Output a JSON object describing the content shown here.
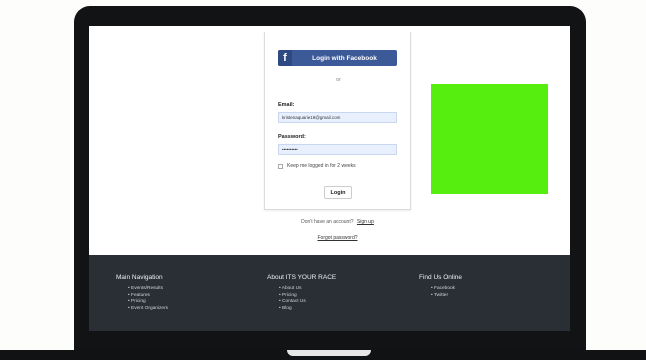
{
  "colors": {
    "facebook_blue": "#3d5a98",
    "green_block": "#55ee0f",
    "footer_bg": "#2a2f36",
    "input_bg": "#e8f0fe"
  },
  "login": {
    "facebook_button_label": "Login with Facebook",
    "facebook_icon_glyph": "f",
    "or_text": "or",
    "email_label": "Email:",
    "email_value": "kristenaquarie19@gmail.com",
    "password_label": "Password:",
    "password_value": "••••••••••",
    "remember_label": "Keep me logged in for 2 weeks",
    "remember_checked": false,
    "login_button_label": "Login"
  },
  "account": {
    "no_account_text": "Don't have an account?",
    "signup_link": "Sign up",
    "forgot_password_link": "Forgot password?"
  },
  "footer": {
    "columns": [
      {
        "heading": "Main Navigation",
        "items": [
          "Events/Results",
          "Features",
          "Pricing",
          "Event Organizers"
        ]
      },
      {
        "heading": "About ITS YOUR RACE",
        "items": [
          "About Us",
          "Pricing",
          "Contact Us",
          "Blog"
        ]
      },
      {
        "heading": "Find Us Online",
        "items": [
          "Facebook",
          "Twitter"
        ]
      }
    ]
  }
}
